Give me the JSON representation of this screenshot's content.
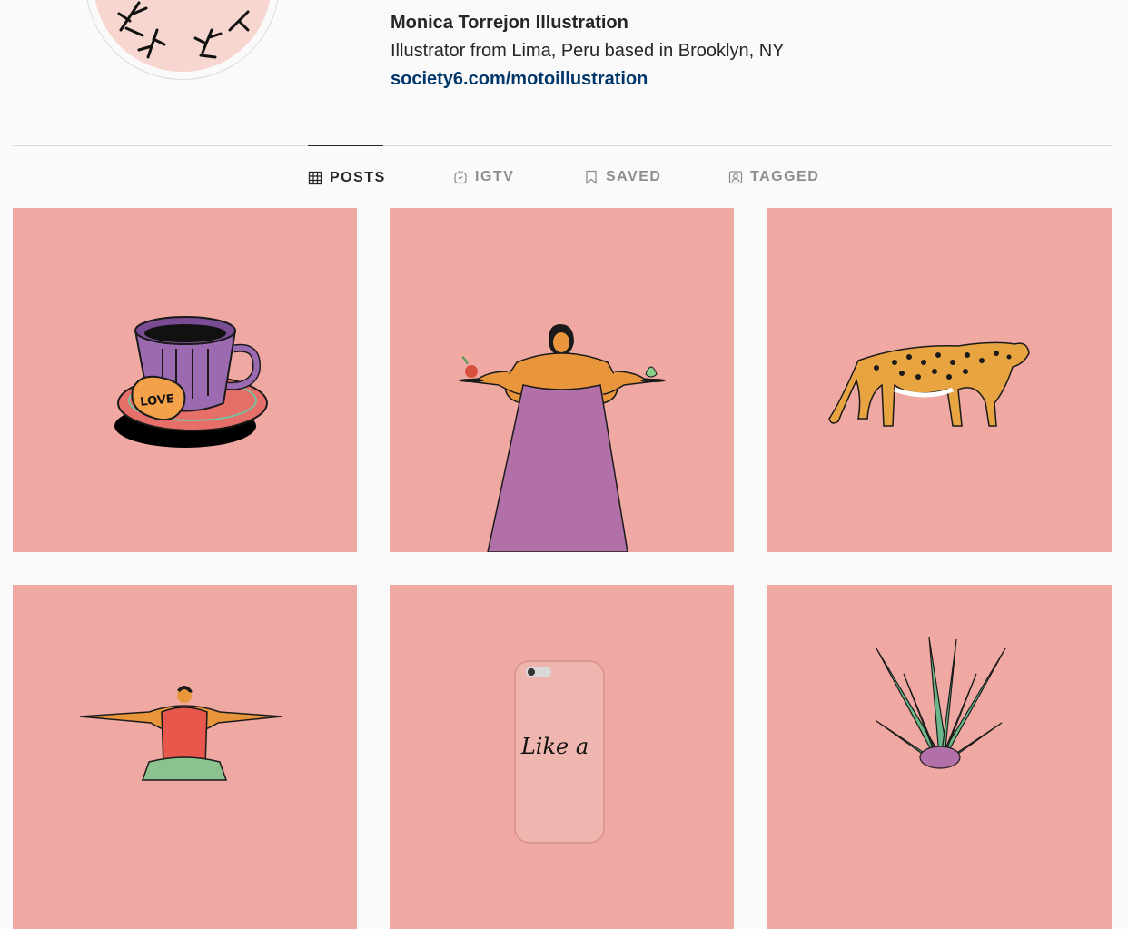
{
  "profile": {
    "name": "Monica Torrejon Illustration",
    "bio": "Illustrator from Lima, Peru based in Brooklyn, NY",
    "link": "society6.com/motoillustration"
  },
  "tabs": [
    {
      "label": "POSTS",
      "icon": "grid-icon",
      "active": true
    },
    {
      "label": "IGTV",
      "icon": "igtv-icon",
      "active": false
    },
    {
      "label": "SAVED",
      "icon": "bookmark-icon",
      "active": false
    },
    {
      "label": "TAGGED",
      "icon": "tagged-user-icon",
      "active": false
    }
  ],
  "posts": {
    "background": "#f0a9a2",
    "items": [
      {
        "subject": "teacup with love cookie",
        "cookie_text": "LOVE"
      },
      {
        "subject": "woman in purple dress holding fruit"
      },
      {
        "subject": "jaguar"
      },
      {
        "subject": "yoga figure in red top"
      },
      {
        "subject": "phone case",
        "phone_text": "Like a"
      },
      {
        "subject": "pineapple plant"
      }
    ]
  },
  "colors": {
    "link": "#00376b",
    "divider": "#dbdbdb",
    "active_tab": "#262626",
    "inactive_tab": "#8e8e8e"
  }
}
